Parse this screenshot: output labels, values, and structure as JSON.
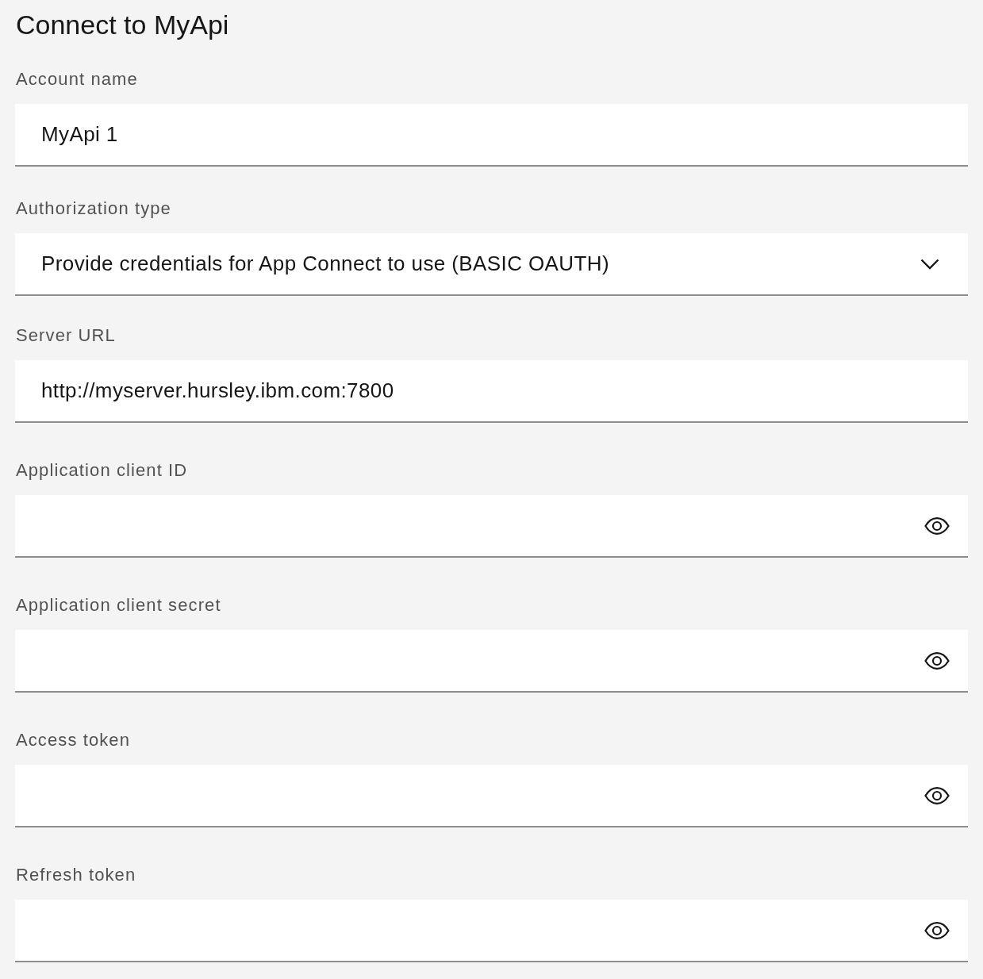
{
  "title": "Connect to MyApi",
  "fields": [
    {
      "kind": "text",
      "label": "Account name",
      "value": "MyApi 1"
    },
    {
      "kind": "select",
      "label": "Authorization type",
      "value": "Provide credentials for App Connect to use (BASIC OAUTH)"
    },
    {
      "kind": "text",
      "label": "Server URL",
      "value": "http://myserver.hursley.ibm.com:7800"
    },
    {
      "kind": "password",
      "label": "Application client ID"
    },
    {
      "kind": "password",
      "label": "Application client secret"
    },
    {
      "kind": "password",
      "label": "Access token"
    },
    {
      "kind": "password",
      "label": "Refresh token"
    }
  ]
}
